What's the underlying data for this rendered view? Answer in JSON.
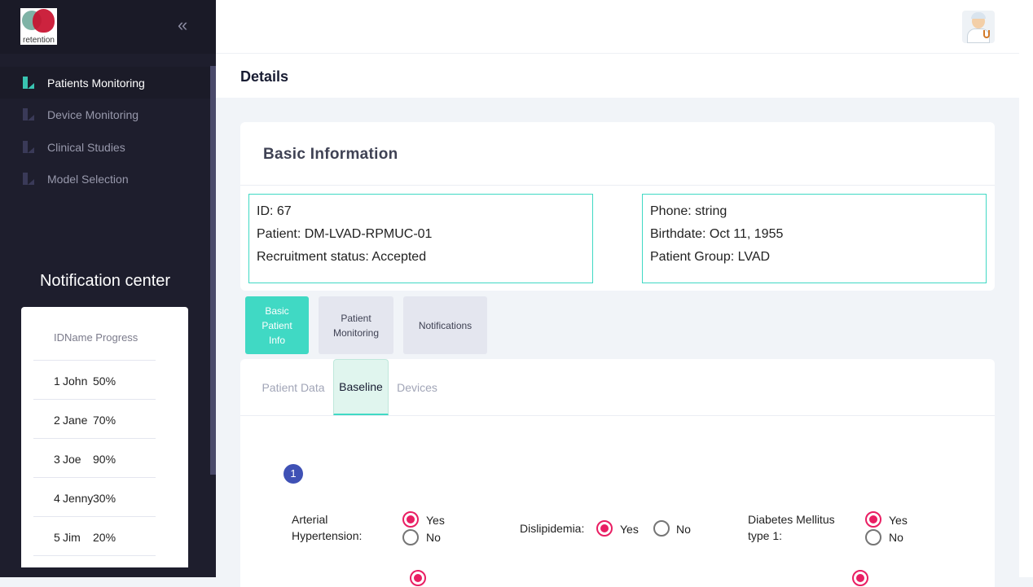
{
  "app": {
    "logo_text": "retention",
    "collapse_icon": "«"
  },
  "sidebar": {
    "items": [
      {
        "label": "Patients Monitoring",
        "active": true
      },
      {
        "label": "Device Monitoring",
        "active": false
      },
      {
        "label": "Clinical Studies",
        "active": false
      },
      {
        "label": "Model Selection",
        "active": false
      }
    ]
  },
  "notifications": {
    "title": "Notification center",
    "header": "IDName Progress",
    "rows": [
      {
        "id": "1",
        "name": "John",
        "progress": "50%"
      },
      {
        "id": "2",
        "name": "Jane",
        "progress": "70%"
      },
      {
        "id": "3",
        "name": "Joe",
        "progress": "90%"
      },
      {
        "id": "4",
        "name": "Jenny",
        "progress": "30%"
      },
      {
        "id": "5",
        "name": "Jim",
        "progress": "20%"
      }
    ]
  },
  "page": {
    "title": "Details"
  },
  "basic_info": {
    "title": "Basic Information",
    "left": {
      "id": "ID: 67",
      "patient": "Patient: DM-LVAD-RPMUC-01",
      "status": "Recruitment status: Accepted"
    },
    "right": {
      "phone": "Phone: string",
      "birthdate": "Birthdate: Oct 11, 1955",
      "group": "Patient Group: LVAD"
    }
  },
  "tabs": {
    "basic": "Basic Patient Info",
    "monitoring": "Patient Monitoring",
    "notifications": "Notifications"
  },
  "subtabs": {
    "patient_data": "Patient Data",
    "baseline": "Baseline",
    "devices": "Devices"
  },
  "baseline": {
    "step": "1",
    "questions": {
      "hypertension": {
        "label": "Arterial Hypertension:",
        "yes": "Yes",
        "no": "No",
        "value": "Yes"
      },
      "dislipidemia": {
        "label": "Dislipidemia:",
        "yes": "Yes",
        "no": "No",
        "value": "Yes"
      },
      "diabetes1": {
        "label": "Diabetes Mellitus type 1:",
        "yes": "Yes",
        "no": "No",
        "value": "Yes"
      }
    }
  },
  "colors": {
    "accent": "#40d9c4",
    "sidebar_bg": "#1e1e2d",
    "radio": "#e91e63",
    "step": "#3f51b5"
  }
}
